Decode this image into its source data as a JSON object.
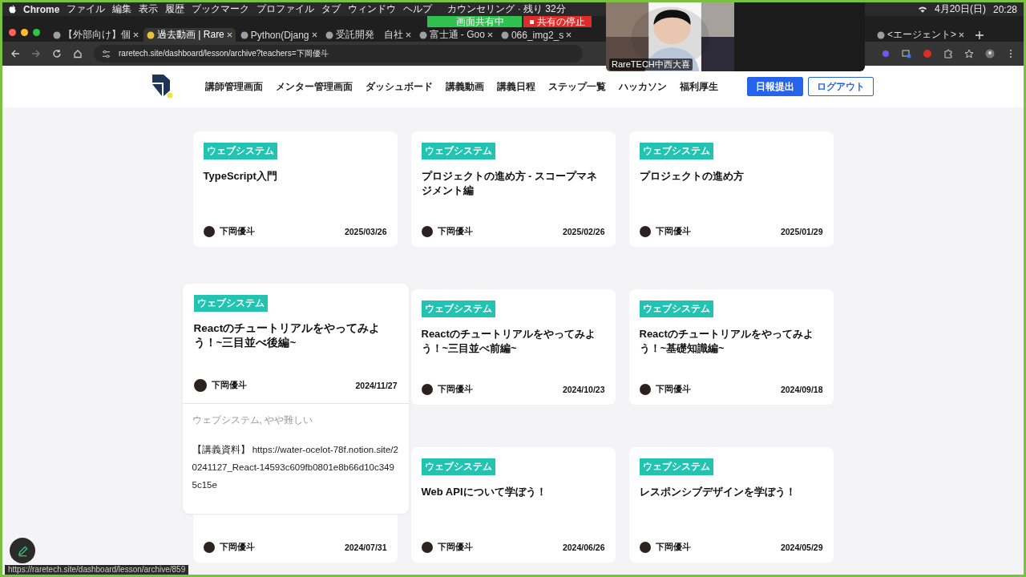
{
  "menubar": {
    "app": "Chrome",
    "menus": [
      "ファイル",
      "編集",
      "表示",
      "履歴",
      "ブックマーク",
      "プロファイル",
      "タブ",
      "ウィンドウ",
      "ヘルプ"
    ],
    "status": "カウンセリング · 残り 32分",
    "date": "4月20日(日)",
    "time": "20:28"
  },
  "tabs": [
    {
      "label": "【外部向け】個",
      "selected": false
    },
    {
      "label": "過去動画 | Rare",
      "selected": true
    },
    {
      "label": "Python(Djang",
      "selected": false
    },
    {
      "label": "受託開発　自社",
      "selected": false
    },
    {
      "label": "富士通 - Goo",
      "selected": false
    },
    {
      "label": "066_img2_s",
      "selected": false
    },
    {
      "label": "<エージェント>",
      "selected": false
    }
  ],
  "share_banner": {
    "status": "画面共有中",
    "stop": "共有の停止"
  },
  "address_bar": {
    "url": "raretech.site/dashboard/lesson/archive?teachers=下岡優斗"
  },
  "video_overlay": {
    "kind": "picture",
    "caption": "RareTECH中西大喜"
  },
  "nav": {
    "links": [
      "講師管理画面",
      "メンター管理画面",
      "ダッシュボード",
      "講義動画",
      "講義日程",
      "ステップ一覧",
      "ハッカソン",
      "福利厚生"
    ],
    "buttons": [
      {
        "label": "日報提出",
        "kind": "primary"
      },
      {
        "label": "ログアウト",
        "kind": "outline"
      }
    ]
  },
  "cards": [
    {
      "tag": "ウェブシステム",
      "title": "TypeScript入門",
      "author": "下岡優斗",
      "date": "2025/03/26",
      "hovered": false
    },
    {
      "tag": "ウェブシステム",
      "title": "プロジェクトの進め方 - スコープマネジメント編",
      "author": "下岡優斗",
      "date": "2025/02/26",
      "hovered": false
    },
    {
      "tag": "ウェブシステム",
      "title": "プロジェクトの進め方",
      "author": "下岡優斗",
      "date": "2025/01/29",
      "hovered": false
    },
    {
      "tag": "ウェブシステム",
      "title": "Reactのチュートリアルをやってみよう！~三目並べ後編~",
      "author": "下岡優斗",
      "date": "2024/11/27",
      "hovered": true,
      "meta": "ウェブシステム, やや難しい",
      "description": "【講義資料】 https://water-ocelot-78f.notion.site/20241127_React-14593c609fb0801e8b66d10c3495c15e"
    },
    {
      "tag": "ウェブシステム",
      "title": "Reactのチュートリアルをやってみよう！~三目並べ前編~",
      "author": "下岡優斗",
      "date": "2024/10/23",
      "hovered": false
    },
    {
      "tag": "ウェブシステム",
      "title": "Reactのチュートリアルをやってみよう！~基礎知識編~",
      "author": "下岡優斗",
      "date": "2024/09/18",
      "hovered": false
    },
    {
      "author": "下岡優斗",
      "date": "2024/07/31",
      "hovered": false
    },
    {
      "tag": "ウェブシステム",
      "title": "Web APIについて学ぼう！",
      "author": "下岡優斗",
      "date": "2024/06/26",
      "hovered": false
    },
    {
      "tag": "ウェブシステム",
      "title": "レスポンシブデザインを学ぼう！",
      "author": "下岡優斗",
      "date": "2024/05/29",
      "hovered": false
    }
  ],
  "status_url": "https://raretech.site/dashboard/lesson/archive/859"
}
